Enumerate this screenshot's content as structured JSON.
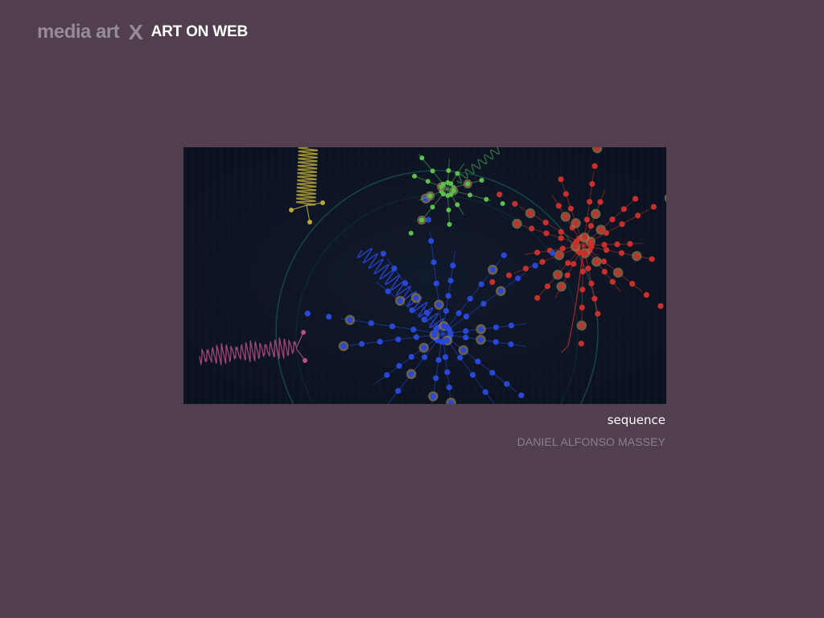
{
  "header": {
    "brand_left": "media art",
    "brand_separator": "X",
    "brand_right": "ART ON WEB"
  },
  "artwork": {
    "title": "sequence",
    "author": "DANIEL ALFONSO MASSEY"
  },
  "colors": {
    "page_background": "#513f4f",
    "artwork_background": "#0c1220",
    "brand_muted": "#958c95",
    "author_muted": "#8c808c",
    "red": "#c8302c",
    "blue": "#2a48d8",
    "green": "#5cbf4e",
    "yellow": "#b8a63a",
    "pink": "#b8508a"
  }
}
